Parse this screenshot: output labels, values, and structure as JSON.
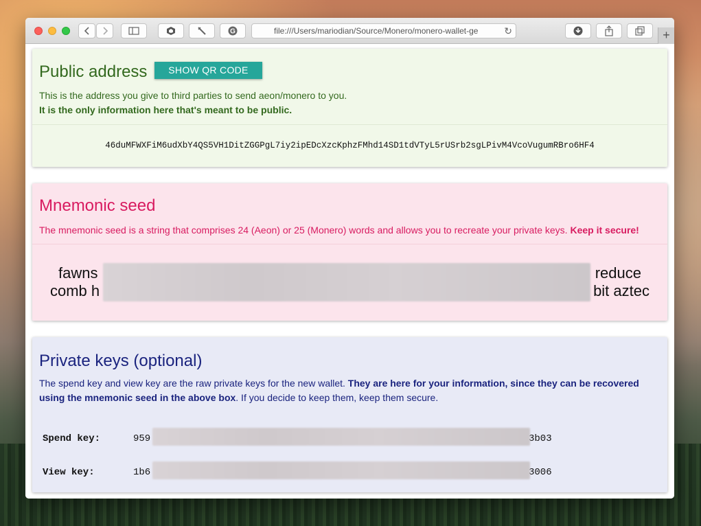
{
  "browser": {
    "url": "file:///Users/mariodian/Source/Monero/monero-wallet-ge",
    "back_icon": "chevron-left-icon",
    "forward_icon": "chevron-right-icon"
  },
  "public_address": {
    "title": "Public address",
    "qr_button": "SHOW QR CODE",
    "desc": "This is the address you give to third parties to send aeon/monero to you.",
    "desc_bold": "It is the only information here that's meant to be public.",
    "address": "46duMFWXFiM6udXbY4QS5VH1DitZGGPgL7iy2ipEDcXzcKphzFMhd14SD1tdVTyL5rUSrb2sgLPivM4VcoVugumRBro6HF4"
  },
  "mnemonic": {
    "title": "Mnemonic seed",
    "desc": "The mnemonic seed is a string that comprises 24 (Aeon) or 25 (Monero) words and allows you to recreate your private keys.",
    "desc_bold": "Keep it secure!",
    "word_first": "fawns",
    "word_last_line1": "reduce",
    "line2_start": "comb h",
    "line2_end": "bit aztec"
  },
  "private_keys": {
    "title": "Private keys (optional)",
    "desc_1": "The spend key and view key are the raw private keys for the new wallet.",
    "desc_bold": "They are here for your information, since they can be recovered using the mnemonic seed in the above box",
    "desc_2": ". If you decide to keep them, keep them secure.",
    "spend_label": "Spend key:",
    "spend_start": "959",
    "spend_end": "3b03",
    "view_label": "View key:",
    "view_start": "1b6",
    "view_end": "3006"
  },
  "colors": {
    "public_bg": "#f1f8e9",
    "public_text": "#33691e",
    "qr_button": "#26a69a",
    "seed_bg": "#fce4ec",
    "seed_text": "#d81b60",
    "keys_bg": "#e8eaf6",
    "keys_text": "#1a237e"
  }
}
